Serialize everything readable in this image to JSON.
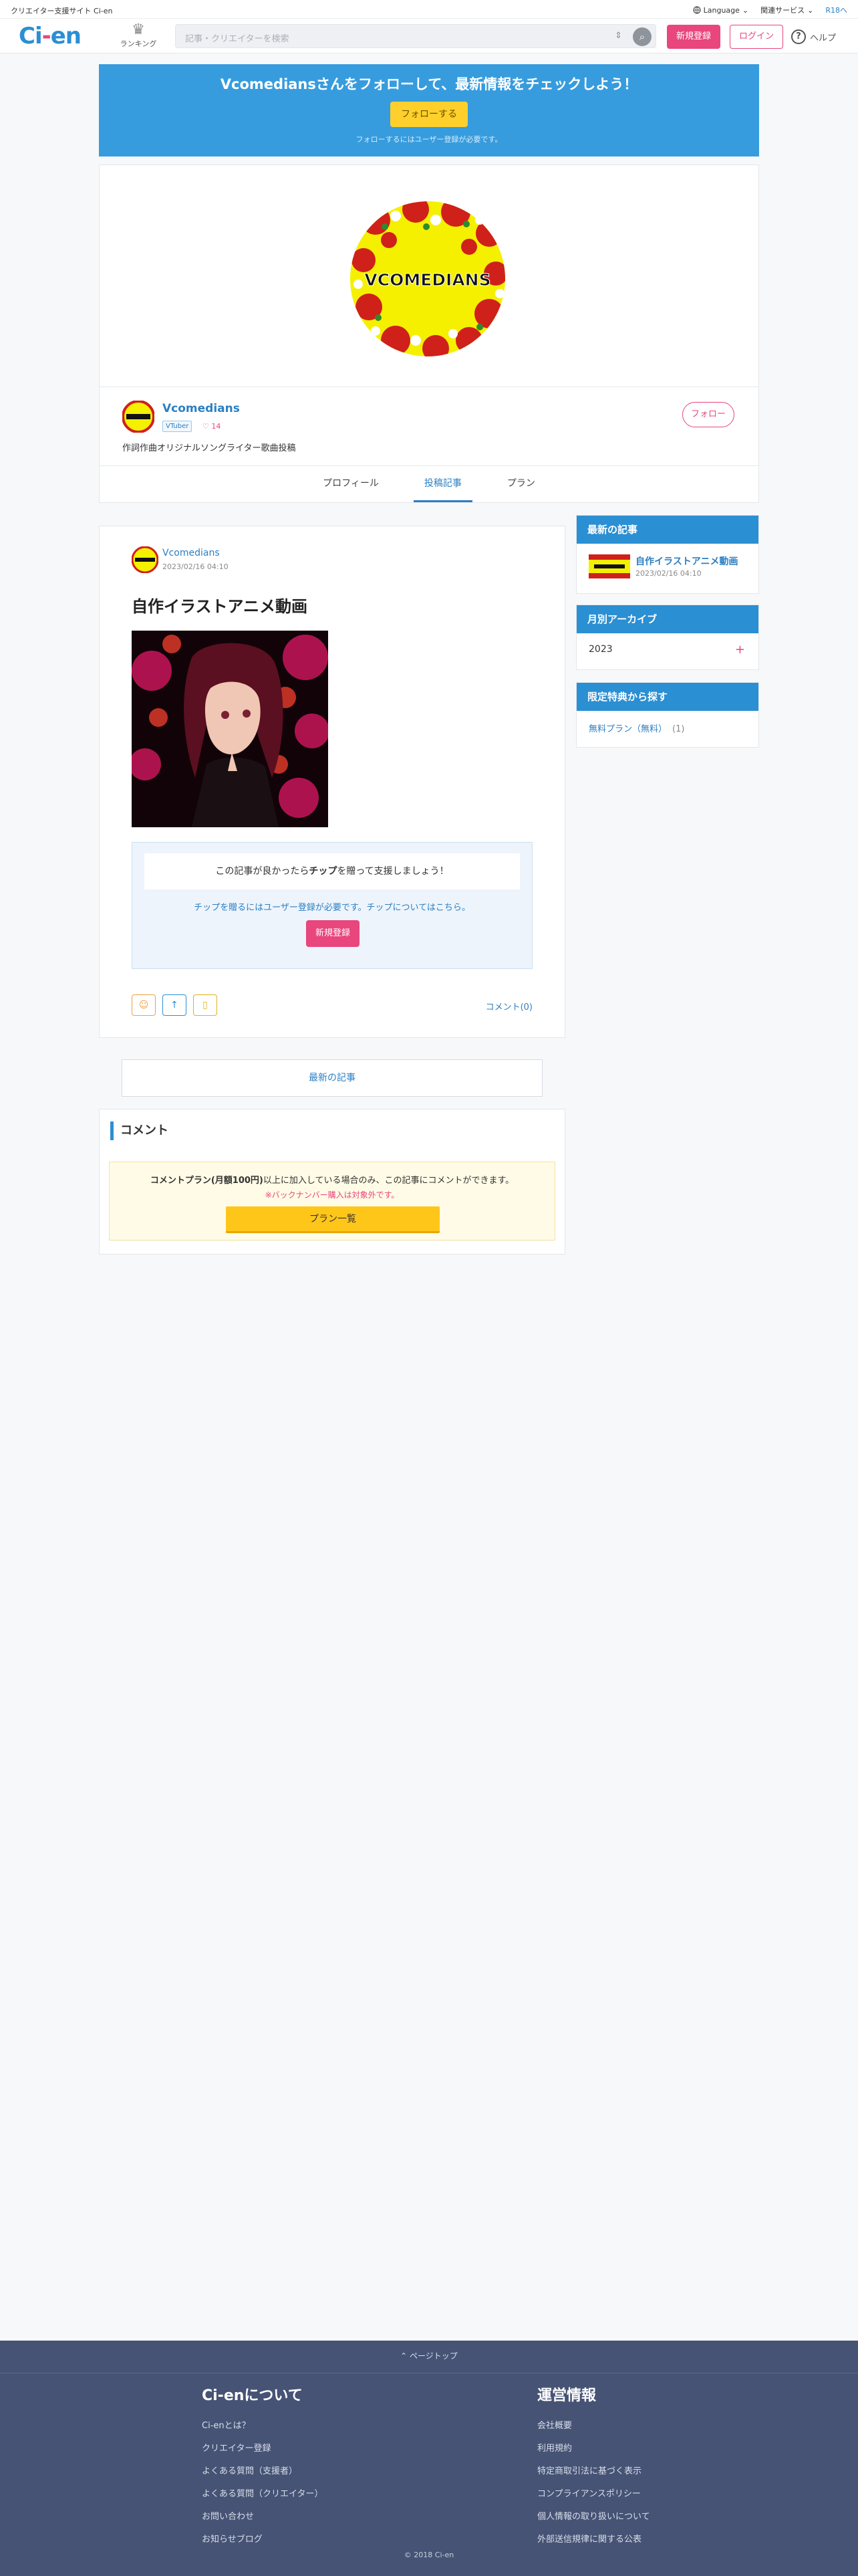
{
  "topbar": {
    "site_desc": "クリエイター支援サイト Ci-en",
    "language": "Language",
    "related": "関連サービス",
    "r18": "R18へ"
  },
  "header": {
    "logo_ci": "Ci",
    "logo_dash": "-",
    "logo_en": "en",
    "ranking_label": "ランキング",
    "search_placeholder": "記事・クリエイターを検索",
    "register_label": "新規登録",
    "login_label": "ログイン",
    "help_label": "ヘルプ"
  },
  "banner": {
    "message": "Vcomediansさんをフォローして、最新情報をチェックしよう！",
    "follow_button": "フォローする",
    "note": "フォローするにはユーザー登録が必要です。"
  },
  "creator": {
    "logo_text": "VCOMEDIANS",
    "name": "Vcomedians",
    "tag": "VTuber",
    "fans": "♡ 14",
    "description": "作詞作曲オリジナルソングライター歌曲投稿",
    "follow_label": "フォロー",
    "tabs": [
      "プロフィール",
      "投稿記事",
      "プラン"
    ]
  },
  "article": {
    "author": "Vcomedians",
    "date": "2023/02/16 04:10",
    "title": "自作イラストアニメ動画",
    "tip_prompt_pre": "この記事が良かったら",
    "tip_prompt_bold": "チップ",
    "tip_prompt_post": "を贈って支援しましょう！",
    "tip_need": "チップを贈るにはユーザー登録が必要です。チップについてはこちら。",
    "register_label": "新規登録",
    "comment_link": "コメント(0)"
  },
  "latest_articles": "最新の記事",
  "comments": {
    "heading": "コメント",
    "line1_bold": "コメントプラン(月額100円)",
    "line1_rest": "以上に加入している場合のみ、この記事にコメントができます。",
    "line2": "※バックナンバー購入は対象外です。",
    "plan_button": "プラン一覧"
  },
  "sidebar": {
    "latest": {
      "heading": "最新の記事",
      "title": "自作イラストアニメ動画",
      "date": "2023/02/16 04:10"
    },
    "archive": {
      "heading": "月別アーカイブ",
      "year": "2023"
    },
    "limited": {
      "heading": "限定特典から探す",
      "plan": "無料プラン（無料）",
      "count": "(1)"
    }
  },
  "footer": {
    "pagetop": "ページトップ",
    "about_heading": "Ci-enについて",
    "about_links": [
      "Ci-enとは？",
      "クリエイター登録",
      "よくある質問（支援者）",
      "よくある質問（クリエイター）",
      "お問い合わせ",
      "お知らせブログ"
    ],
    "ops_heading": "運営情報",
    "ops_links": [
      "会社概要",
      "利用規約",
      "特定商取引法に基づく表示",
      "コンプライアンスポリシー",
      "個人情報の取り扱いについて",
      "外部送信規律に関する公表"
    ],
    "copyright": "© 2018 Ci-en"
  },
  "colors": {
    "accent_blue": "#2b8fd3",
    "accent_pink": "#e8467c",
    "follow_yellow": "#ffd02b",
    "footer_bg": "#465375"
  }
}
